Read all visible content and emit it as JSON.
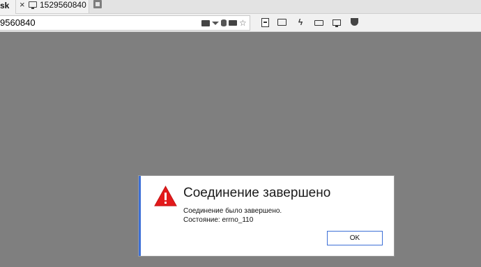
{
  "tabs": {
    "partial_label": "sk",
    "active_label": "1529560840"
  },
  "toolbar": {
    "url_text": "9560840"
  },
  "dialog": {
    "title": "Соединение завершено",
    "message": "Соединение было завершено.",
    "status": "Состояние: errno_110",
    "ok_label": "OK"
  },
  "colors": {
    "background": "#7f7f7f",
    "dialog_accent": "#3c6fd6",
    "warning_red": "#e3191b"
  }
}
